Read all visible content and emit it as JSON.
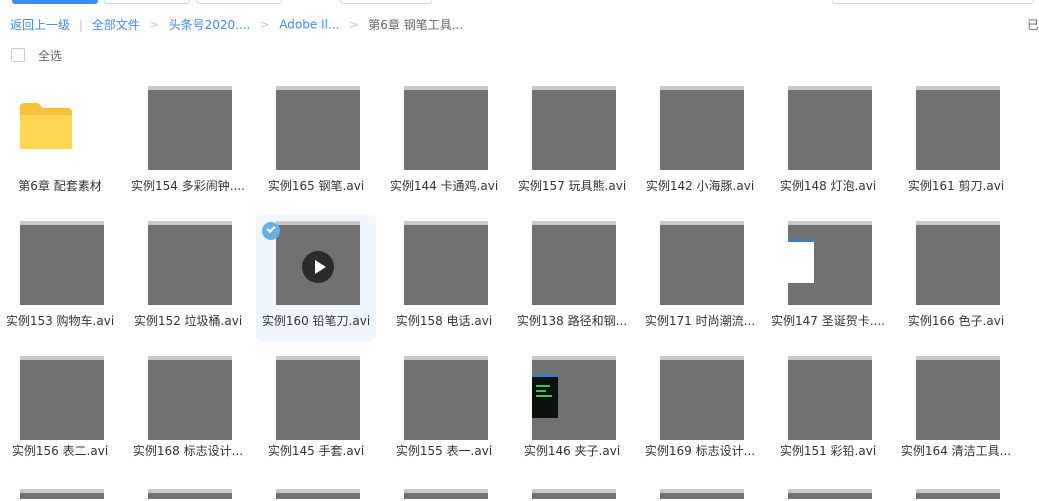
{
  "breadcrumb": {
    "back": "返回上一级",
    "items": [
      "全部文件",
      "头条号2020....",
      "Adobe Il...",
      "第6章 钢笔工具..."
    ]
  },
  "right_status": "已",
  "select_all_label": "全选",
  "colors": {
    "accent": "#3b8cff",
    "thumb": "#717171",
    "folder": "#ffd04b",
    "selected_bg": "#f0f6fd"
  },
  "files": [
    {
      "name": "第6章 配套素材",
      "type": "folder",
      "icon": "folder-icon"
    },
    {
      "name": "实例154 多彩闹钟....",
      "type": "video"
    },
    {
      "name": "实例165 钢笔.avi",
      "type": "video"
    },
    {
      "name": "实例144 卡通鸡.avi",
      "type": "video"
    },
    {
      "name": "实例157 玩具熊.avi",
      "type": "video"
    },
    {
      "name": "实例142 小海豚.avi",
      "type": "video"
    },
    {
      "name": "实例148 灯泡.avi",
      "type": "video"
    },
    {
      "name": "实例161 剪刀.avi",
      "type": "video"
    },
    {
      "name": "实例153 购物车.avi",
      "type": "video"
    },
    {
      "name": "实例152 垃圾桶.avi",
      "type": "video"
    },
    {
      "name": "实例160 铅笔刀.avi",
      "type": "video",
      "selected": true,
      "icon": "play-icon"
    },
    {
      "name": "实例158 电话.avi",
      "type": "video"
    },
    {
      "name": "实例138 路径和钢...",
      "type": "video"
    },
    {
      "name": "实例171 时尚潮流...",
      "type": "video"
    },
    {
      "name": "实例147 圣诞贺卡....",
      "type": "video"
    },
    {
      "name": "实例166 色子.avi",
      "type": "video"
    },
    {
      "name": "实例156 表二.avi",
      "type": "video"
    },
    {
      "name": "实例168 标志设计...",
      "type": "video"
    },
    {
      "name": "实例145 手套.avi",
      "type": "video"
    },
    {
      "name": "实例155 表一.avi",
      "type": "video"
    },
    {
      "name": "实例146 夹子.avi",
      "type": "video"
    },
    {
      "name": "实例169 标志设计...",
      "type": "video"
    },
    {
      "name": "实例151 彩铅.avi",
      "type": "video"
    },
    {
      "name": "实例164 清洁工具...",
      "type": "video"
    }
  ]
}
